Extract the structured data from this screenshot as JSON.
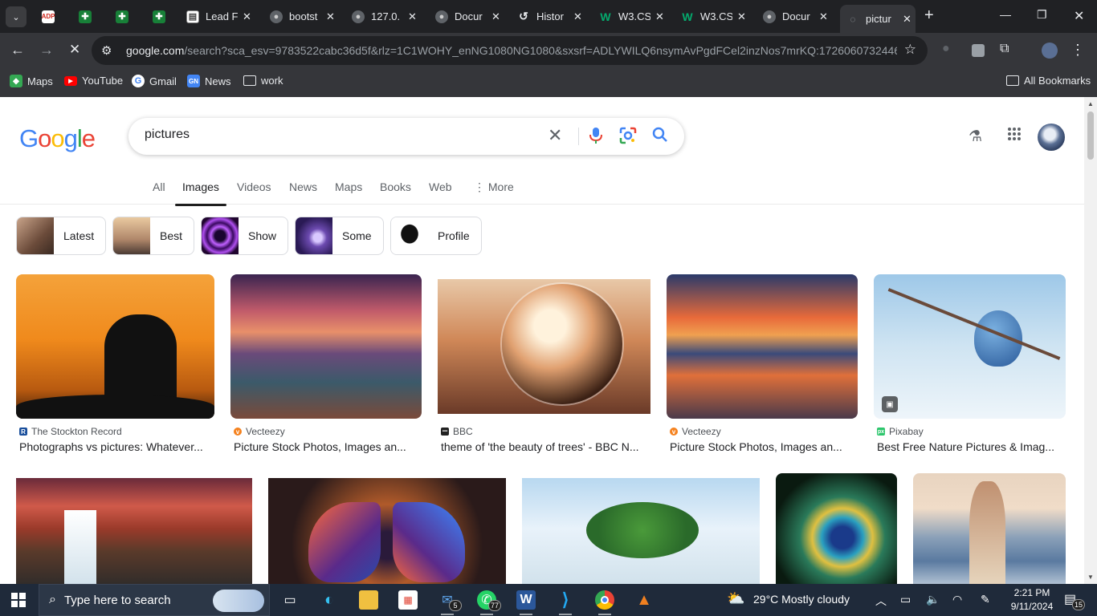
{
  "browser": {
    "tabs": [
      {
        "title": "",
        "favicon": "adp-icon",
        "color": "#d0271d"
      },
      {
        "title": "",
        "favicon": "sheets-icon",
        "color": "#188038"
      },
      {
        "title": "",
        "favicon": "sheets-icon",
        "color": "#188038"
      },
      {
        "title": "",
        "favicon": "sheets-icon",
        "color": "#188038"
      },
      {
        "title": "Lead F",
        "favicon": "doc-icon",
        "color": "#e8eaed"
      },
      {
        "title": "bootst",
        "favicon": "globe-icon",
        "color": "#9aa0a6"
      },
      {
        "title": "127.0.",
        "favicon": "globe-icon",
        "color": "#9aa0a6"
      },
      {
        "title": "Docur",
        "favicon": "globe-icon",
        "color": "#9aa0a6"
      },
      {
        "title": "Histor",
        "favicon": "history-icon",
        "color": "#e8eaed"
      },
      {
        "title": "W3.CS",
        "favicon": "w3schools-icon",
        "color": "#04aa6d"
      },
      {
        "title": "W3.CS",
        "favicon": "w3schools-icon",
        "color": "#04aa6d"
      },
      {
        "title": "Docur",
        "favicon": "globe-icon",
        "color": "#9aa0a6"
      },
      {
        "title": "pictur",
        "favicon": "loading-icon",
        "color": "#9aa0a6",
        "active": true
      }
    ],
    "url_host": "google.com",
    "url_rest": "/search?sca_esv=9783522cabc36d5f&rlz=1C1WOHY_enNG1080NG1080&sxsrf=ADLYWILQ6nsymAvPgdFCel2inzNos7mrKQ:1726060732446...",
    "bookmarks": [
      {
        "label": "Maps",
        "icon": "maps-icon"
      },
      {
        "label": "YouTube",
        "icon": "youtube-icon"
      },
      {
        "label": "Gmail",
        "icon": "google-icon"
      },
      {
        "label": "News",
        "icon": "news-icon"
      },
      {
        "label": "work",
        "icon": "folder-icon"
      }
    ],
    "all_bookmarks": "All Bookmarks"
  },
  "google": {
    "logo": "Google",
    "query": "pictures",
    "nav": [
      "All",
      "Images",
      "Videos",
      "News",
      "Maps",
      "Books",
      "Web",
      "More"
    ],
    "selected_nav": "Images",
    "chips": [
      "Latest",
      "Best",
      "Show",
      "Some",
      "Profile"
    ],
    "results_row1": [
      {
        "source": "The Stockton Record",
        "title": "Photographs vs pictures: Whatever..."
      },
      {
        "source": "Vecteezy",
        "title": "Picture Stock Photos, Images an..."
      },
      {
        "source": "BBC",
        "title": "theme of 'the beauty of trees' - BBC N..."
      },
      {
        "source": "Vecteezy",
        "title": "Picture Stock Photos, Images an..."
      },
      {
        "source": "Pixabay",
        "title": "Best Free Nature Pictures & Imag..."
      }
    ]
  },
  "taskbar": {
    "search_placeholder": "Type here to search",
    "mail_badge": "5",
    "whatsapp_badge": "77",
    "weather": "29°C  Mostly cloudy",
    "time": "2:21 PM",
    "date": "9/11/2024",
    "notifications": "15"
  }
}
